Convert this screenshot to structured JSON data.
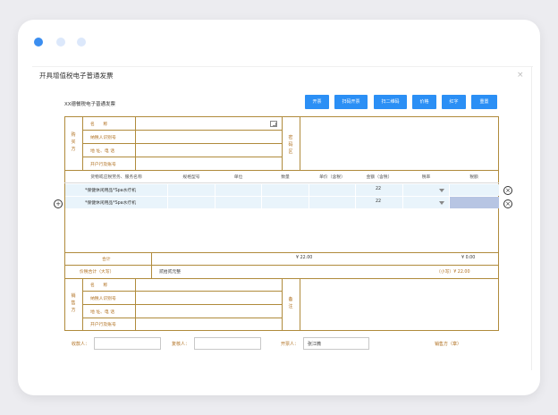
{
  "window": {
    "dots": [
      "#3b8ef0",
      "#dce8fb",
      "#dce8fb"
    ]
  },
  "dialog": {
    "title": "开具增值税电子普通发票",
    "close": "×"
  },
  "invoice": {
    "name": "XX德餐税电子普通发票"
  },
  "toolbar": {
    "buttons": [
      "开票",
      "扫码开票",
      "扫二维码",
      "价格",
      "红字",
      "重置"
    ]
  },
  "buyer": {
    "side_label": "购买方",
    "fields": [
      "名　　称",
      "纳税人识别号",
      "地 址、电 话",
      "开户行及账号"
    ],
    "password_label": "密码区"
  },
  "items": {
    "columns": [
      "货物或应税劳务、服务名称",
      "规格型号",
      "单位",
      "数量",
      "单价（含税）",
      "金额（含税）",
      "税率",
      "税额"
    ],
    "rows": [
      {
        "name": "*保健休闲用品*Spa水疗机",
        "amount": "22"
      },
      {
        "name": "*保健休闲用品*Spa水疗机",
        "amount": "22"
      }
    ]
  },
  "totals": {
    "subtotal_label": "合计",
    "subtotal_amount": "¥ 22.00",
    "subtotal_tax": "¥ 0.00",
    "grand_label": "价税合计（大写）",
    "grand_words": "贰拾贰元整",
    "grand_small": "（小写）¥ 22.00"
  },
  "seller": {
    "side_label": "销售方",
    "fields": [
      "名　　称",
      "纳税人识别号",
      "地 址、电 话",
      "开户行及账号"
    ],
    "remark_label": "备注"
  },
  "footer": {
    "payee_label": "收款人：",
    "payee_value": "",
    "reviewer_label": "复核人：",
    "reviewer_value": "",
    "drawer_label": "开票人：",
    "drawer_value": "张江微",
    "seller_seal": "销售方（章）"
  }
}
